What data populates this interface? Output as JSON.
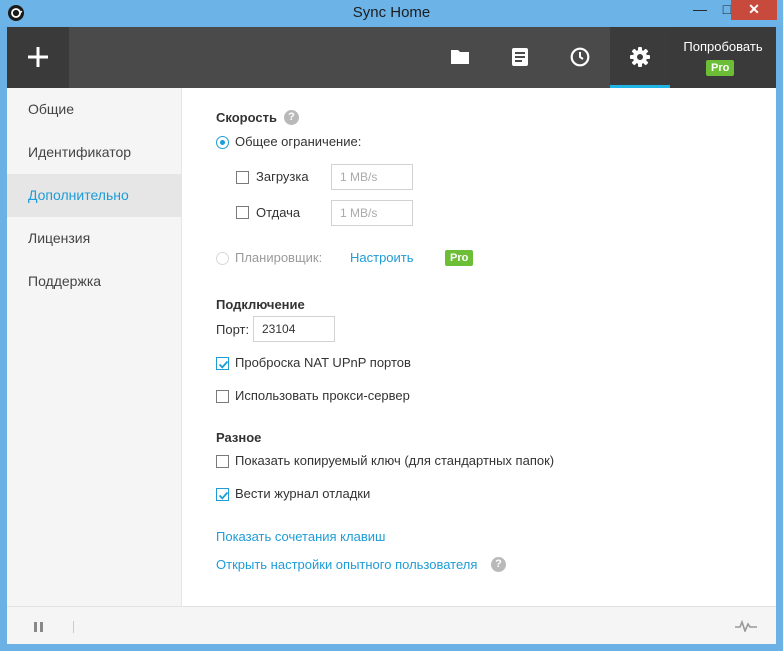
{
  "window": {
    "title": "Sync Home",
    "minimize": "—",
    "maximize": "□",
    "close": "✕"
  },
  "toolbar": {
    "add_icon": "plus-icon",
    "folders_icon": "folder-icon",
    "transfers_icon": "list-icon",
    "history_icon": "clock-icon",
    "settings_icon": "gear-icon",
    "try_label": "Попробовать",
    "pro_badge": "Pro",
    "accent": "#1fb3e6"
  },
  "sidebar": {
    "items": [
      {
        "label": "Общие"
      },
      {
        "label": "Идентификатор"
      },
      {
        "label": "Дополнительно"
      },
      {
        "label": "Лицензия"
      },
      {
        "label": "Поддержка"
      }
    ],
    "active_index": 2
  },
  "speed": {
    "title": "Скорость",
    "help": "?",
    "global_limit_label": "Общее ограничение:",
    "global_limit_selected": true,
    "download_label": "Загрузка",
    "download_checked": false,
    "download_placeholder": "1 MB/s",
    "upload_label": "Отдача",
    "upload_checked": false,
    "upload_placeholder": "1 MB/s",
    "scheduler_label": "Планировщик:",
    "scheduler_selected": false,
    "configure_link": "Настроить",
    "pro_badge": "Pro"
  },
  "connection": {
    "title": "Подключение",
    "port_label": "Порт:",
    "port_value": "23104",
    "nat_label": "Проброска NAT UPnP портов",
    "nat_checked": true,
    "proxy_label": "Использовать прокси-сервер",
    "proxy_checked": false
  },
  "misc": {
    "title": "Разное",
    "show_key_label": "Показать копируемый ключ (для стандартных папок)",
    "show_key_checked": false,
    "debug_log_label": "Вести журнал отладки",
    "debug_log_checked": true
  },
  "links": {
    "shortcuts": "Показать сочетания клавиш",
    "power_user": "Открыть настройки опытного пользователя",
    "help": "?"
  },
  "statusbar": {
    "pause_icon": "pause-icon",
    "activity_icon": "pulse-icon"
  },
  "colors": {
    "accent": "#1e9cd7",
    "pro_green": "#6cbe36",
    "toolbar": "#4a4a4a",
    "titlebar": "#6cb3e8"
  }
}
